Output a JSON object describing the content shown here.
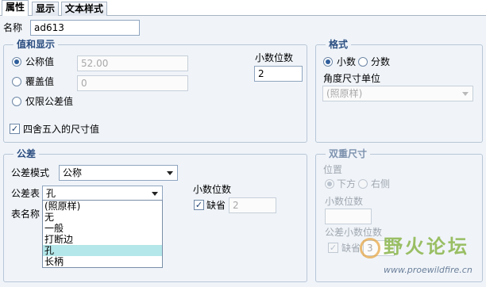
{
  "tabs": [
    {
      "label": "属性",
      "active": true
    },
    {
      "label": "显示",
      "active": false
    },
    {
      "label": "文本样式",
      "active": false
    }
  ],
  "name": {
    "label": "名称",
    "value": "ad613"
  },
  "value_display": {
    "title": "值和显示",
    "nominal": {
      "label": "公称值",
      "value": "52.00",
      "selected": true
    },
    "override": {
      "label": "覆盖值",
      "value": "0",
      "selected": false
    },
    "tol_only": {
      "label": "仅限公差值",
      "selected": false
    },
    "decimals": {
      "label": "小数位数",
      "value": "2"
    },
    "round": {
      "label": "四舍五入的尺寸值",
      "checked": true
    }
  },
  "format": {
    "title": "格式",
    "decimal": {
      "label": "小数",
      "selected": true
    },
    "fraction": {
      "label": "分数",
      "selected": false
    },
    "angle_label": "角度尺寸单位",
    "angle_value": "(照原样)"
  },
  "tolerance": {
    "title": "公差",
    "mode_label": "公差模式",
    "mode_value": "公称",
    "table_label": "公差表",
    "table_value": "孔",
    "table_name_label": "表名称",
    "decimals_label": "小数位数",
    "default_label": "缺省",
    "default_checked": true,
    "default_value": "2",
    "options": [
      {
        "label": "(照原样)",
        "selected": false
      },
      {
        "label": "无",
        "selected": false
      },
      {
        "label": "一般",
        "selected": false
      },
      {
        "label": "打断边",
        "selected": false
      },
      {
        "label": "孔",
        "selected": true
      },
      {
        "label": "长柄",
        "selected": false
      }
    ]
  },
  "dual": {
    "title": "双重尺寸",
    "position_label": "位置",
    "below": {
      "label": "下方",
      "selected": true
    },
    "right": {
      "label": "右侧",
      "selected": false
    },
    "decimals_label": "小数位数",
    "tol_decimals_label": "公差小数位数",
    "default_label": "缺省",
    "default_value": "3"
  },
  "watermark": {
    "text": "野火论坛",
    "url": "www.proewildfire.cn"
  }
}
